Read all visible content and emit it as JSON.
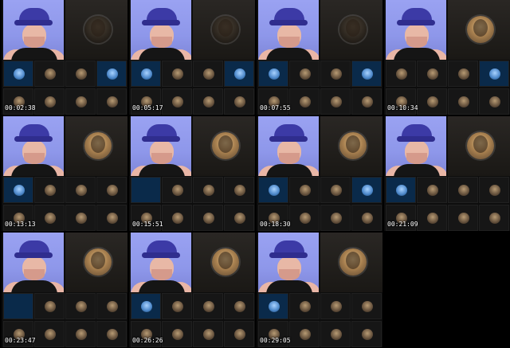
{
  "tiles": [
    {
      "timestamp": "00:02:38"
    },
    {
      "timestamp": "00:05:17"
    },
    {
      "timestamp": "00:07:55"
    },
    {
      "timestamp": "00:10:34"
    },
    {
      "timestamp": "00:13:13"
    },
    {
      "timestamp": "00:15:51"
    },
    {
      "timestamp": "00:18:30"
    },
    {
      "timestamp": "00:21:09"
    },
    {
      "timestamp": "00:23:47"
    },
    {
      "timestamp": "00:26:26"
    },
    {
      "timestamp": "00:29:05"
    }
  ],
  "colors": {
    "background": "#000000",
    "cap": "#3c3aa6",
    "blue_thumb": "#0a2a4a"
  }
}
